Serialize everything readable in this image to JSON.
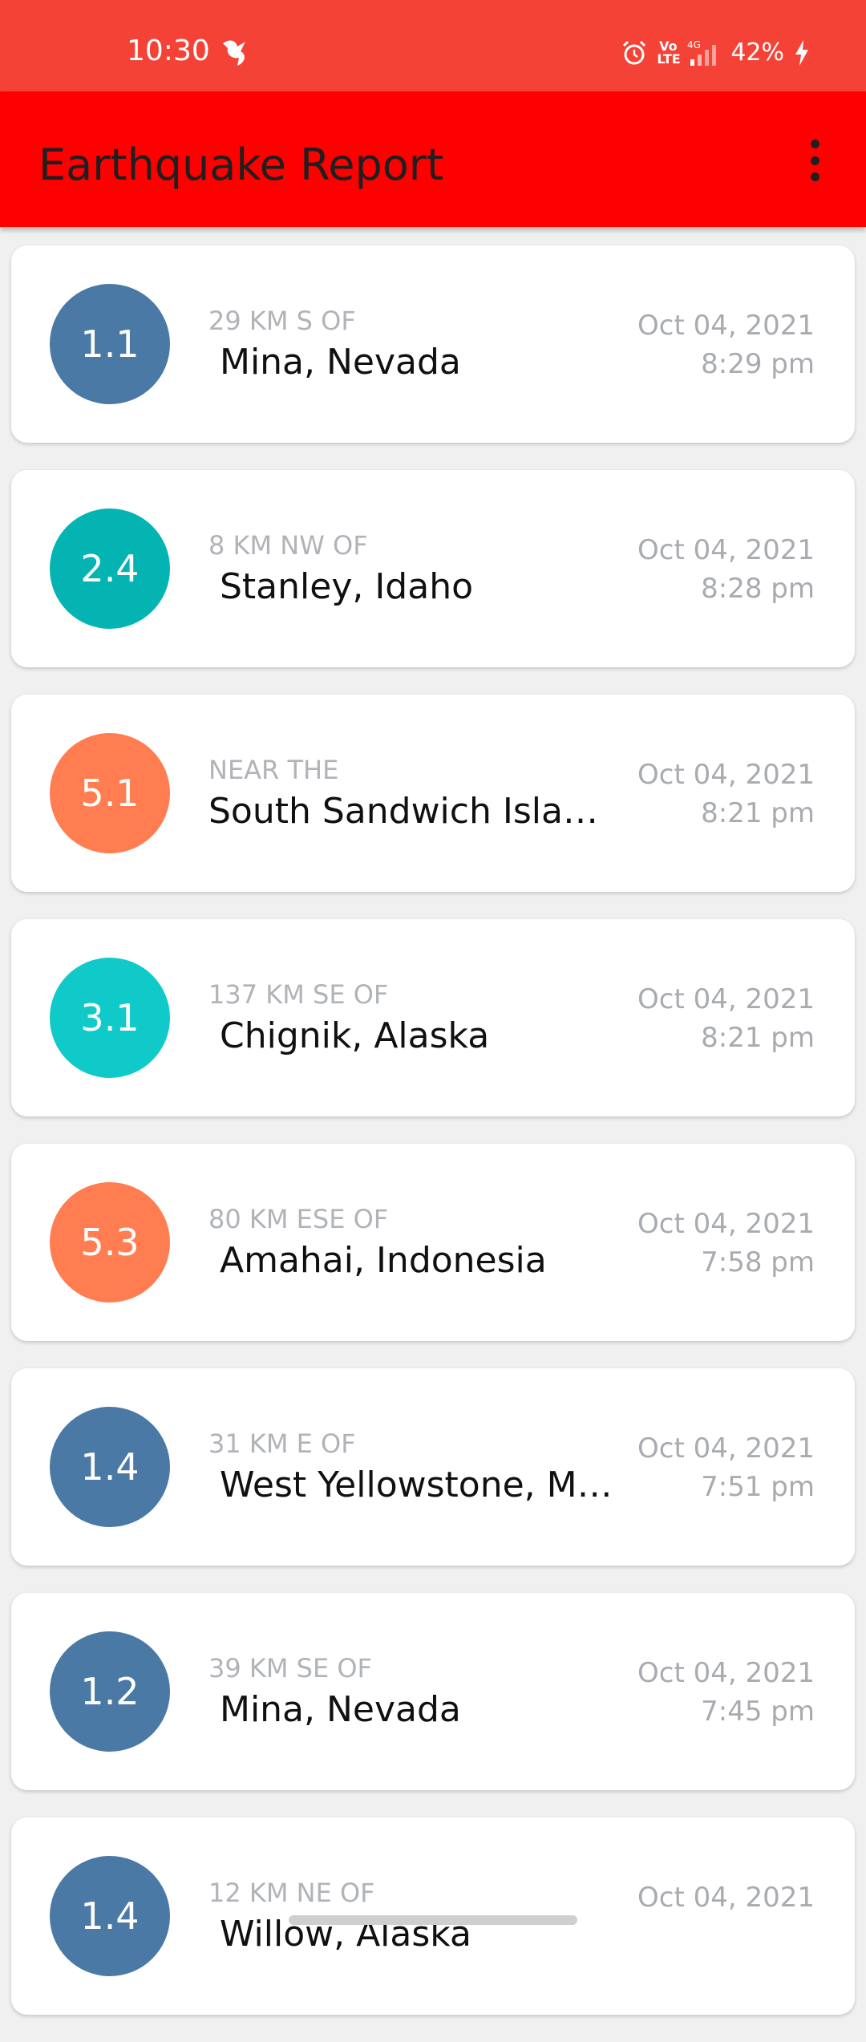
{
  "status_bar": {
    "time": "10:30",
    "volte_label": "Vo\nLTE",
    "network_label": "4G",
    "battery_percent": "42%",
    "color": "#f44336",
    "icons": [
      "app-notification-icon",
      "alarm-icon",
      "volte-icon",
      "signal-icon",
      "battery-charging-icon"
    ]
  },
  "app_bar": {
    "title": "Earthquake Report",
    "color": "#ff0000",
    "menu_icon": "more-vert-icon"
  },
  "earthquakes": [
    {
      "magnitude": "1.1",
      "offset": "29 km S of",
      "place": " Mina, Nevada",
      "date": "Oct 04, 2021",
      "time": "8:29 pm",
      "color": "#4a79a6"
    },
    {
      "magnitude": "2.4",
      "offset": "8 km NW of",
      "place": " Stanley, Idaho",
      "date": "Oct 04, 2021",
      "time": "8:28 pm",
      "color": "#04b4b3"
    },
    {
      "magnitude": "5.1",
      "offset": "Near the",
      "place": "South Sandwich Islands region",
      "date": "Oct 04, 2021",
      "time": "8:21 pm",
      "color": "#ff7d50"
    },
    {
      "magnitude": "3.1",
      "offset": "137 km SE of",
      "place": " Chignik, Alaska",
      "date": "Oct 04, 2021",
      "time": "8:21 pm",
      "color": "#10cac9"
    },
    {
      "magnitude": "5.3",
      "offset": "80 km ESE of",
      "place": " Amahai, Indonesia",
      "date": "Oct 04, 2021",
      "time": "7:58 pm",
      "color": "#ff7d50"
    },
    {
      "magnitude": "1.4",
      "offset": "31 km E of",
      "place": " West Yellowstone, Montana",
      "date": "Oct 04, 2021",
      "time": "7:51 pm",
      "color": "#4a79a6"
    },
    {
      "magnitude": "1.2",
      "offset": "39 km SE of",
      "place": " Mina, Nevada",
      "date": "Oct 04, 2021",
      "time": "7:45 pm",
      "color": "#4a79a6"
    },
    {
      "magnitude": "1.4",
      "offset": "12 km NE of",
      "place": " Willow, Alaska",
      "date": "Oct 04, 2021",
      "time": "",
      "color": "#4a79a6"
    }
  ]
}
